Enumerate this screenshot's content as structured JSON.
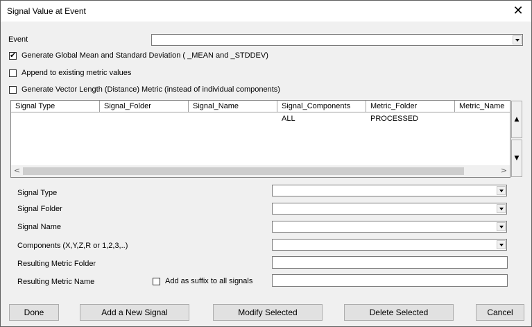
{
  "window": {
    "title": "Signal Value at Event",
    "close_glyph": "✕"
  },
  "event": {
    "label": "Event",
    "value": ""
  },
  "options": {
    "global_mean": {
      "label": "Generate Global Mean and Standard Deviation ( _MEAN and _STDDEV)",
      "checked": true
    },
    "append": {
      "label": "Append to existing metric values",
      "checked": false
    },
    "vector_length": {
      "label": "Generate Vector Length (Distance) Metric (instead of individual components)",
      "checked": false
    }
  },
  "grid": {
    "columns": [
      "Signal Type",
      "Signal_Folder",
      "Signal_Name",
      "Signal_Components",
      "Metric_Folder",
      "Metric_Name"
    ],
    "rows": [
      [
        "",
        "",
        "",
        "ALL",
        "PROCESSED",
        ""
      ]
    ],
    "scroll_left": "<",
    "scroll_right": ">",
    "scroll_up": "▲",
    "scroll_down": "▼"
  },
  "form": {
    "signal_type": {
      "label": "Signal Type",
      "value": ""
    },
    "signal_folder": {
      "label": "Signal Folder",
      "value": ""
    },
    "signal_name": {
      "label": "Signal Name",
      "value": ""
    },
    "components": {
      "label": "Components (X,Y,Z,R or 1,2,3,..)",
      "value": ""
    },
    "metric_folder": {
      "label": "Resulting Metric Folder",
      "value": ""
    },
    "metric_name": {
      "label": "Resulting Metric Name",
      "value": ""
    },
    "suffix": {
      "label": "Add as suffix to all signals",
      "checked": false
    }
  },
  "buttons": {
    "done": "Done",
    "add": "Add a New Signal",
    "modify": "Modify Selected",
    "delete": "Delete Selected",
    "cancel": "Cancel"
  }
}
